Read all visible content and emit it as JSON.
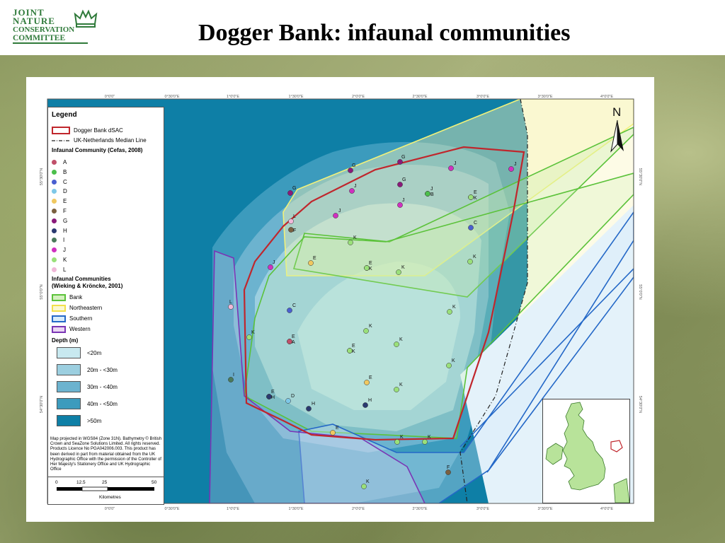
{
  "header": {
    "logo_lines": [
      "JOINT",
      "NATURE",
      "CONSERVATION",
      "COMMITTEE"
    ],
    "title": "Dogger Bank: infaunal communities"
  },
  "map": {
    "top_ticks": [
      "0°0'0\"",
      "0°30'0\"E",
      "1°0'0\"E",
      "1°30'0\"E",
      "2°0'0\"E",
      "2°30'0\"E",
      "3°0'0\"E",
      "3°30'0\"E",
      "4°0'0\"E"
    ],
    "bottom_ticks": [
      "0°0'0\"",
      "0°30'0\"E",
      "1°0'0\"E",
      "1°30'0\"E",
      "2°0'0\"E",
      "2°30'0\"E",
      "3°0'0\"E",
      "3°30'0\"E",
      "4°0'0\"E"
    ],
    "left_ticks": [
      "55°30'0\"N",
      "55°0'0\"N",
      "54°30'0\"N"
    ],
    "right_ticks": [
      "55°30'0\"N",
      "55°0'0\"N",
      "54°30'0\"N"
    ],
    "north_label": "N",
    "colors": {
      "deep": "#0e7fa6",
      "depth_40_50": "#3c9bbd",
      "depth_30_40": "#6cb3cf",
      "depth_20_30": "#9ccfe0",
      "shallow": "#c8e9f0",
      "dsac": "#c0262c",
      "bank": "#5bc23a",
      "northeastern": "#f2f27a",
      "southern": "#2468c7",
      "western": "#7a35b5"
    },
    "stations": [
      {
        "label": "G",
        "community": "G"
      },
      {
        "label": "G",
        "community": "G"
      },
      {
        "label": "J",
        "community": "J"
      },
      {
        "label": "J",
        "community": "J"
      },
      {
        "label": "G",
        "community": "G"
      },
      {
        "label": "J",
        "community": "J"
      },
      {
        "label": "G",
        "community": "G"
      },
      {
        "label": "J",
        "community": "J"
      },
      {
        "label": "J",
        "community": "J"
      },
      {
        "label": "B",
        "community": "B"
      },
      {
        "label": "E",
        "community": "E"
      },
      {
        "label": "K",
        "community": "K"
      },
      {
        "label": "J",
        "community": "J"
      },
      {
        "label": "L",
        "community": "L"
      },
      {
        "label": "F",
        "community": "F"
      },
      {
        "label": "C",
        "community": "C"
      },
      {
        "label": "K",
        "community": "K"
      },
      {
        "label": "K",
        "community": "K"
      },
      {
        "label": "E",
        "community": "E"
      },
      {
        "label": "E",
        "community": "E"
      },
      {
        "label": "K",
        "community": "K"
      },
      {
        "label": "K",
        "community": "K"
      },
      {
        "label": "J",
        "community": "J"
      },
      {
        "label": "L",
        "community": "L"
      },
      {
        "label": "C",
        "community": "C"
      },
      {
        "label": "K",
        "community": "K"
      },
      {
        "label": "K",
        "community": "K"
      },
      {
        "label": "E",
        "community": "E"
      },
      {
        "label": "A",
        "community": "A"
      },
      {
        "label": "K",
        "community": "K"
      },
      {
        "label": "E",
        "community": "E"
      },
      {
        "label": "K",
        "community": "K"
      },
      {
        "label": "K",
        "community": "K"
      },
      {
        "label": "I",
        "community": "I"
      },
      {
        "label": "E",
        "community": "E"
      },
      {
        "label": "H",
        "community": "H"
      },
      {
        "label": "D",
        "community": "D"
      },
      {
        "label": "H",
        "community": "H"
      },
      {
        "label": "H",
        "community": "H"
      },
      {
        "label": "E",
        "community": "E"
      },
      {
        "label": "K",
        "community": "K"
      },
      {
        "label": "E",
        "community": "E"
      },
      {
        "label": "K",
        "community": "K"
      },
      {
        "label": "K",
        "community": "K"
      },
      {
        "label": "F",
        "community": "F"
      },
      {
        "label": "K",
        "community": "K"
      },
      {
        "label": "K",
        "community": "K"
      }
    ]
  },
  "legend": {
    "title": "Legend",
    "dsac_label": "Dogger Bank dSAC",
    "median_label": "UK-Netherlands Median Line",
    "infaunal_heading": "Infaunal Community (Cefas, 2008)",
    "communities": [
      {
        "code": "A",
        "color": "#c0506a"
      },
      {
        "code": "B",
        "color": "#4cbf4c"
      },
      {
        "code": "C",
        "color": "#4a5fd0"
      },
      {
        "code": "D",
        "color": "#7ec8e8"
      },
      {
        "code": "E",
        "color": "#f0c860"
      },
      {
        "code": "F",
        "color": "#7a6040"
      },
      {
        "code": "G",
        "color": "#8a1a7a"
      },
      {
        "code": "H",
        "color": "#2a3a70"
      },
      {
        "code": "I",
        "color": "#4a7a5a"
      },
      {
        "code": "J",
        "color": "#d030c0"
      },
      {
        "code": "K",
        "color": "#9ae07a"
      },
      {
        "code": "L",
        "color": "#f0b8d8"
      }
    ],
    "wieking_heading_1": "Infaunal Communities",
    "wieking_heading_2": "(Wieking & Kröncke, 2001)",
    "wieking": [
      {
        "label": "Bank",
        "color": "#5bc23a",
        "fill": "#d4f0c0"
      },
      {
        "label": "Northeastern",
        "color": "#f2e04a",
        "fill": "#fbf8d0"
      },
      {
        "label": "Southern",
        "color": "#2468c7",
        "fill": "#d8ecfa"
      },
      {
        "label": "Western",
        "color": "#7a35b5",
        "fill": "#ead6f2"
      }
    ],
    "depth_heading": "Depth (m)",
    "depths": [
      {
        "label": "<20m",
        "color": "#c8e9f0"
      },
      {
        "label": "20m - <30m",
        "color": "#9ccfe0"
      },
      {
        "label": "30m - <40m",
        "color": "#6cb3cf"
      },
      {
        "label": "40m - <50m",
        "color": "#3c9bbd"
      },
      {
        "label": ">50m",
        "color": "#0e7fa6"
      }
    ],
    "note": "Map projected in WGS84 (Zone 31N). Bathymetry © British Crown and SeaZone Solutions Limited. All rights reserved. Products Licence No PGA042006.003. This product has been derived in part from material obtained from the UK Hydrographic Office with the permission of the Controller of Her Majesty's Stationery Office and UK Hydrographic Office"
  },
  "scalebar": {
    "ticks": [
      "0",
      "12.5",
      "25",
      "50"
    ],
    "unit": "Kilometres"
  }
}
